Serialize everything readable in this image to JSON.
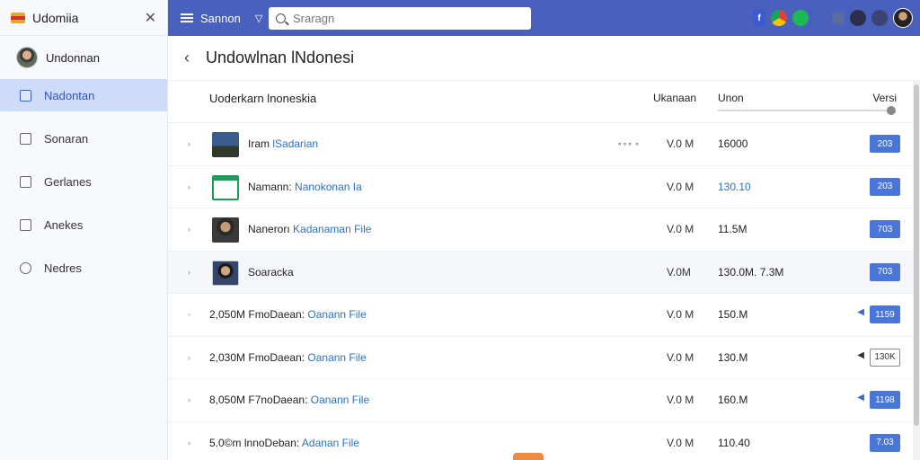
{
  "app": {
    "brand": "Udomiia"
  },
  "sidebar": {
    "user": "Undonnan",
    "items": [
      {
        "label": "Nadontan",
        "active": true
      },
      {
        "label": "Sonaran"
      },
      {
        "label": "Gerlanes"
      },
      {
        "label": "Anekes"
      },
      {
        "label": "Nedres"
      }
    ]
  },
  "topbar": {
    "label": "Sannon",
    "search_placeholder": "Sraragn",
    "icons": [
      "facebook-icon",
      "chrome-icon",
      "green-app-icon",
      "square-app-icon",
      "dark-app-icon",
      "dots-app-icon",
      "profile-icon"
    ]
  },
  "main": {
    "title": "Undowlnan lNdonesi",
    "columns": {
      "name": "Uoderkarn lnoneskia",
      "size": "Ukanaan",
      "unit": "Unon",
      "version": "Versi"
    },
    "rows": [
      {
        "thumb": "sky",
        "name_prefix": "Iram ",
        "name_link": "lSadarian",
        "micro": "∘∘∘ ∘",
        "size": "V.0 M",
        "unit": "16000",
        "unit_blue": false,
        "badge": "203",
        "badge_style": "solid",
        "arrow": ""
      },
      {
        "thumb": "folder",
        "name_prefix": "Namann: ",
        "name_link": "Nanokonan Ia",
        "micro": "",
        "size": "V.0 M",
        "unit": "130.10",
        "unit_blue": true,
        "badge": "203",
        "badge_style": "solid",
        "arrow": ""
      },
      {
        "thumb": "person",
        "name_prefix": "Nanerorı ",
        "name_link": "Kadanaman File",
        "micro": "",
        "size": "V.0 M",
        "unit": "11.5M",
        "unit_blue": false,
        "badge": "703",
        "badge_style": "solid",
        "arrow": ""
      },
      {
        "thumb": "person2",
        "name_prefix": "Soaracka",
        "name_link": "",
        "micro": "",
        "size": "V.0M",
        "unit": "130.0M. 7.3M",
        "unit_blue": false,
        "badge": "703",
        "badge_style": "solid",
        "arrow": ""
      },
      {
        "thumb": "",
        "name_prefix": "2,050M FmoDaean: ",
        "name_link": "Oanann File",
        "micro": "",
        "size": "V.0 M",
        "unit": "150.M",
        "unit_blue": false,
        "badge": "1159",
        "badge_style": "solid",
        "arrow": "◀"
      },
      {
        "thumb": "",
        "name_prefix": "2,030M FmoDaean: ",
        "name_link": "Oanann File",
        "micro": "",
        "size": "V.0 M",
        "unit": "130.M",
        "unit_blue": false,
        "badge": "130K",
        "badge_style": "outline",
        "arrow": "◀"
      },
      {
        "thumb": "",
        "name_prefix": "8,050M F7noDaean: ",
        "name_link": "Oanann File",
        "micro": "",
        "size": "V.0 M",
        "unit": "160.M",
        "unit_blue": false,
        "badge": "1198",
        "badge_style": "solid",
        "arrow": "◀"
      },
      {
        "thumb": "",
        "name_prefix": "5.0©m lnnoDeban: ",
        "name_link": "Adanan File",
        "micro": "",
        "size": "V.0 M",
        "unit": "110.40",
        "unit_blue": false,
        "badge": "7.03",
        "badge_style": "solid",
        "arrow": ""
      }
    ]
  },
  "colors": {
    "topbar": "#4a60bd",
    "active_nav": "#cfdcf7",
    "badge": "#4a76d8",
    "link": "#2a72c8"
  }
}
